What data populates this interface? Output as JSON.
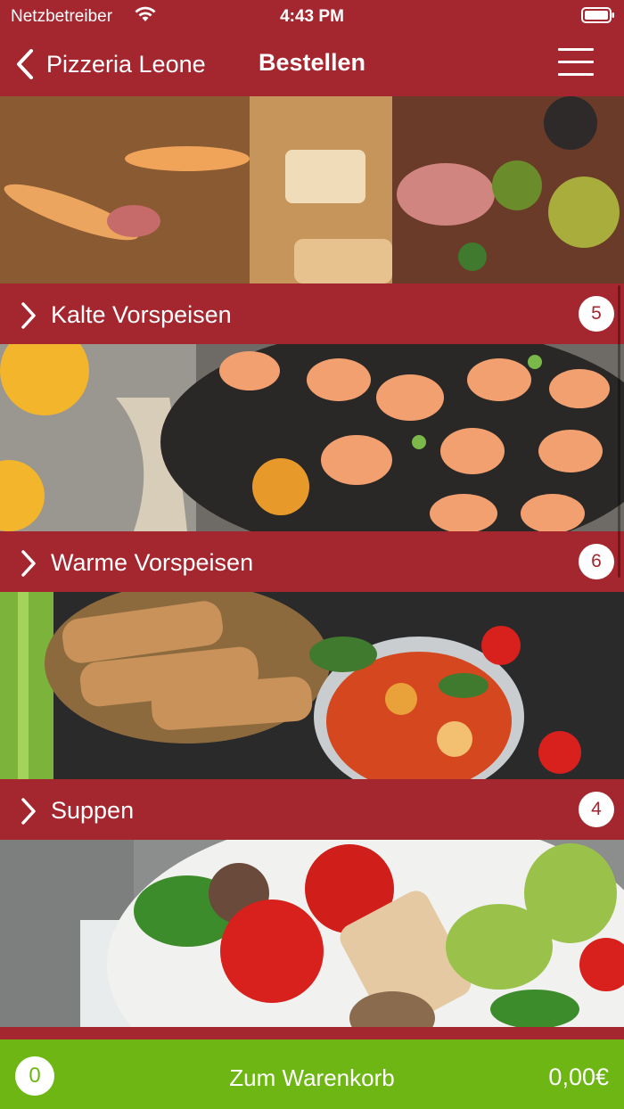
{
  "status_bar": {
    "carrier": "Netzbetreiber",
    "time": "4:43 PM",
    "icons": [
      "wifi-icon",
      "battery-icon"
    ]
  },
  "nav": {
    "back_label": "Pizzeria Leone",
    "title": "Bestellen",
    "icons": [
      "chevron-left-icon",
      "menu-icon"
    ]
  },
  "categories": [
    {
      "label": "Kalte Vorspeisen",
      "count": "5",
      "image": "antipasti-platter-image"
    },
    {
      "label": "Warme Vorspeisen",
      "count": "6",
      "image": "grilled-shrimp-image"
    },
    {
      "label": "Suppen",
      "count": "4",
      "image": "tomato-soup-image"
    },
    {
      "label": "",
      "count": "",
      "image": "salad-image"
    }
  ],
  "cart": {
    "count": "0",
    "label": "Zum Warenkorb",
    "total": "0,00€"
  },
  "colors": {
    "brand": "#a4262f",
    "cart": "#6eb614"
  }
}
